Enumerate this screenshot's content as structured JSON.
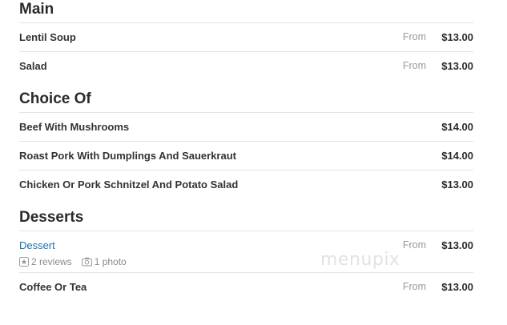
{
  "sections": [
    {
      "title": "Main",
      "items": [
        {
          "name": "Lentil Soup",
          "from": "From",
          "price": "$13.00"
        },
        {
          "name": "Salad",
          "from": "From",
          "price": "$13.00"
        }
      ]
    },
    {
      "title": "Choice Of",
      "items": [
        {
          "name": "Beef With Mushrooms",
          "price": "$14.00"
        },
        {
          "name": "Roast Pork With Dumplings And Sauerkraut",
          "price": "$14.00"
        },
        {
          "name": "Chicken Or Pork Schnitzel And Potato Salad",
          "price": "$13.00"
        }
      ]
    },
    {
      "title": "Desserts",
      "items": [
        {
          "name": "Dessert",
          "from": "From",
          "price": "$13.00",
          "reviews": "2 reviews",
          "photos": "1 photo"
        },
        {
          "name": "Coffee Or Tea",
          "from": "From",
          "price": "$13.00"
        }
      ]
    }
  ],
  "watermark": "menupix",
  "colors": {
    "link": "#1a73a8",
    "muted": "#999999",
    "divider": "#e3e3e3"
  },
  "icons": {
    "reviews": "star-badge-icon",
    "photos": "camera-icon"
  }
}
